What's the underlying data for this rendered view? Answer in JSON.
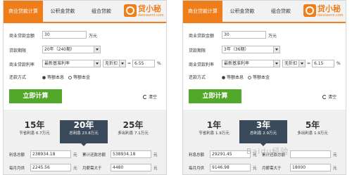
{
  "logo": {
    "name": "贷小秘",
    "domain": "daixiaomi.com"
  },
  "panels": [
    {
      "tabs": [
        "商业贷款计算",
        "公积金贷款",
        "组合贷款"
      ],
      "form": {
        "amount_label": "商业贷款金额",
        "amount_value": "30",
        "amount_unit": "万元",
        "term_label": "贷款期限",
        "term_value": "20年（240期）",
        "rate_label": "商业贷款利率",
        "rate_type": "最新基准利率",
        "discount": "无折扣",
        "rate_value": "6.55",
        "rate_unit": "%",
        "method_label": "还款方式",
        "method_options": [
          "等额本息",
          "等额本金"
        ]
      },
      "calc_label": "立即计算",
      "clear_label": "清空",
      "cards": [
        {
          "big": "15年",
          "small": "节省利息 6.7万元"
        },
        {
          "big": "20年",
          "small": "总利息 23.8万元"
        },
        {
          "big": "25年",
          "small": "多出利息 7.1万元"
        }
      ],
      "results": {
        "interest_label": "利息总额",
        "interest_value": "238934.18",
        "interest_unit": "元",
        "total_label": "累计还款总额",
        "total_value": "538934.18",
        "total_unit": "元",
        "monthly_label": "每月月供",
        "monthly_value": "2245.56",
        "monthly_unit": "元",
        "income_label": "月薪需大于",
        "income_value": "4480",
        "income_unit": "元"
      }
    },
    {
      "tabs": [
        "商业贷款计算",
        "公积金贷款",
        "组合贷款"
      ],
      "form": {
        "amount_label": "商业贷款金额",
        "amount_value": "30",
        "amount_unit": "万元",
        "term_label": "贷款期限",
        "term_value": "3年（36期）",
        "rate_label": "商业贷款利率",
        "rate_type": "最新基准利率",
        "discount": "无折扣",
        "rate_value": "6.15",
        "rate_unit": "%",
        "method_label": "还款方式",
        "method_options": [
          "等额本息",
          "等额本金"
        ]
      },
      "calc_label": "立即计算",
      "clear_label": "清空",
      "cards": [
        {
          "big": "1年",
          "small": "节省利息 1.9万元"
        },
        {
          "big": "3年",
          "small": "总利息 2.9万元"
        },
        {
          "big": "5年",
          "small": "多出利息 1.9万元"
        }
      ],
      "results": {
        "interest_label": "利息总额",
        "interest_value": "29291.45",
        "interest_unit": "元",
        "total_label": "累计还款总额",
        "total_value": "",
        "total_unit": "元",
        "monthly_label": "每月月供",
        "monthly_value": "9146.98",
        "monthly_unit": "元",
        "income_label": "月薪需大于",
        "income_value": "18000",
        "income_unit": "元"
      }
    }
  ],
  "watermark": "Baidu经验"
}
